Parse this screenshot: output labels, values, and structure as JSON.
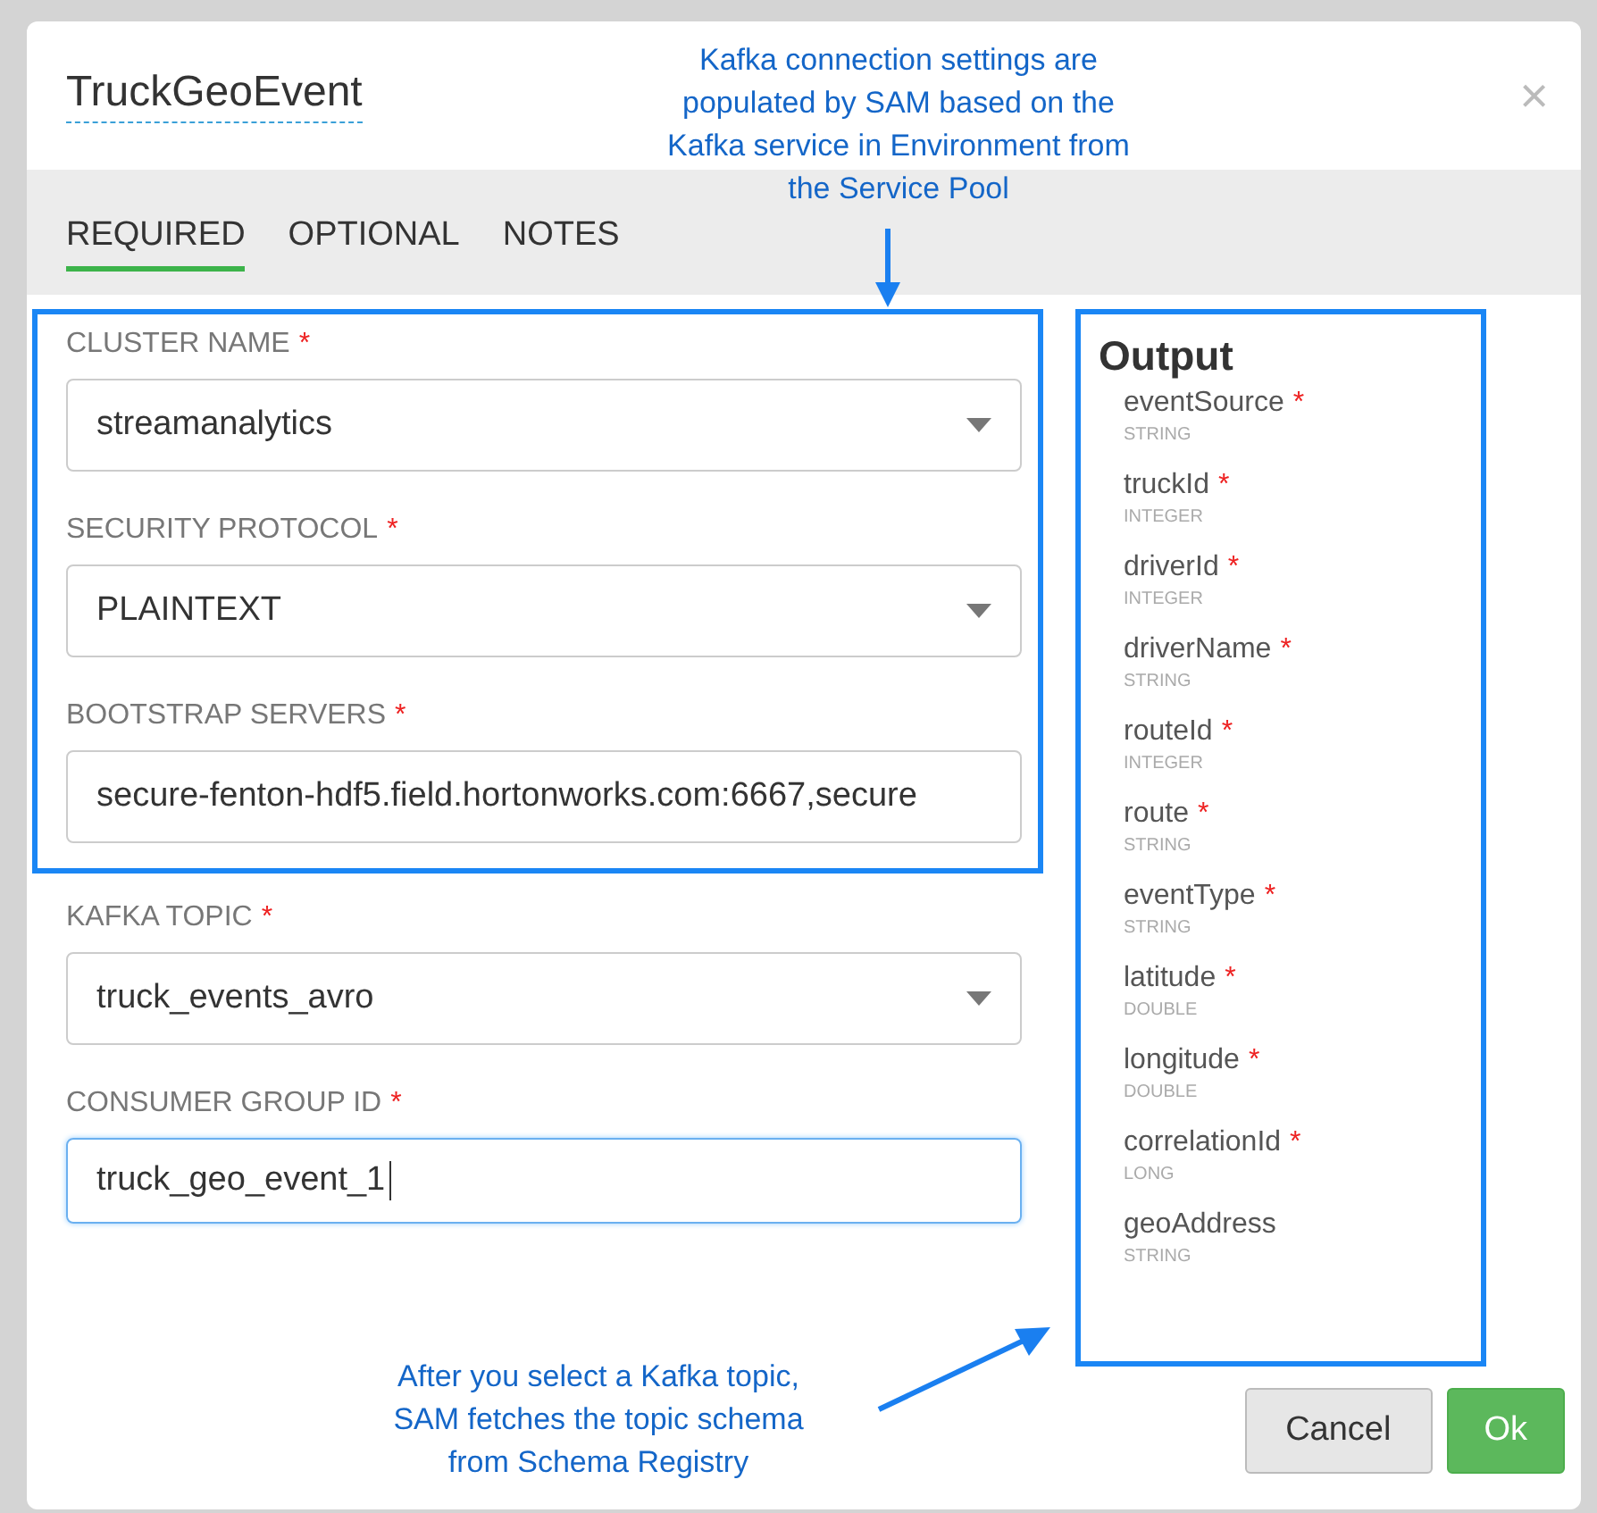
{
  "dialog": {
    "title": "TruckGeoEvent",
    "close": "×"
  },
  "tabs": [
    {
      "label": "REQUIRED",
      "selected": true
    },
    {
      "label": "OPTIONAL",
      "selected": false
    },
    {
      "label": "NOTES",
      "selected": false
    }
  ],
  "form": {
    "highlighted_fields": [
      {
        "label": "CLUSTER NAME",
        "required_mark": "*",
        "kind": "select",
        "value": "streamanalytics",
        "focused": false
      },
      {
        "label": "SECURITY PROTOCOL",
        "required_mark": "*",
        "kind": "select",
        "value": "PLAINTEXT",
        "focused": false
      },
      {
        "label": "BOOTSTRAP SERVERS",
        "required_mark": "*",
        "kind": "text",
        "value": "secure-fenton-hdf5.field.hortonworks.com:6667,secure",
        "focused": false
      }
    ],
    "fields": [
      {
        "label": "KAFKA TOPIC",
        "required_mark": "*",
        "kind": "select",
        "value": "truck_events_avro",
        "focused": false
      },
      {
        "label": "CONSUMER GROUP ID",
        "required_mark": "*",
        "kind": "text",
        "value": "truck_geo_event_1",
        "focused": true
      }
    ]
  },
  "output": {
    "title": "Output",
    "fields": [
      {
        "name": "eventSource",
        "type": "STRING",
        "required_mark": "*"
      },
      {
        "name": "truckId",
        "type": "INTEGER",
        "required_mark": "*"
      },
      {
        "name": "driverId",
        "type": "INTEGER",
        "required_mark": "*"
      },
      {
        "name": "driverName",
        "type": "STRING",
        "required_mark": "*"
      },
      {
        "name": "routeId",
        "type": "INTEGER",
        "required_mark": "*"
      },
      {
        "name": "route",
        "type": "STRING",
        "required_mark": "*"
      },
      {
        "name": "eventType",
        "type": "STRING",
        "required_mark": "*"
      },
      {
        "name": "latitude",
        "type": "DOUBLE",
        "required_mark": "*"
      },
      {
        "name": "longitude",
        "type": "DOUBLE",
        "required_mark": "*"
      },
      {
        "name": "correlationId",
        "type": "LONG",
        "required_mark": "*"
      },
      {
        "name": "geoAddress",
        "type": "STRING"
      }
    ]
  },
  "buttons": [
    {
      "label": "Cancel",
      "kind": "secondary"
    },
    {
      "label": "Ok",
      "kind": "primary"
    }
  ],
  "annotations": [
    {
      "kind": "top",
      "text": "Kafka connection settings are\npopulated by SAM based on the\nKafka service in Environment from\nthe Service Pool"
    },
    {
      "kind": "bottom",
      "text": "After you select a Kafka topic,\nSAM fetches the topic schema\nfrom Schema Registry"
    }
  ]
}
